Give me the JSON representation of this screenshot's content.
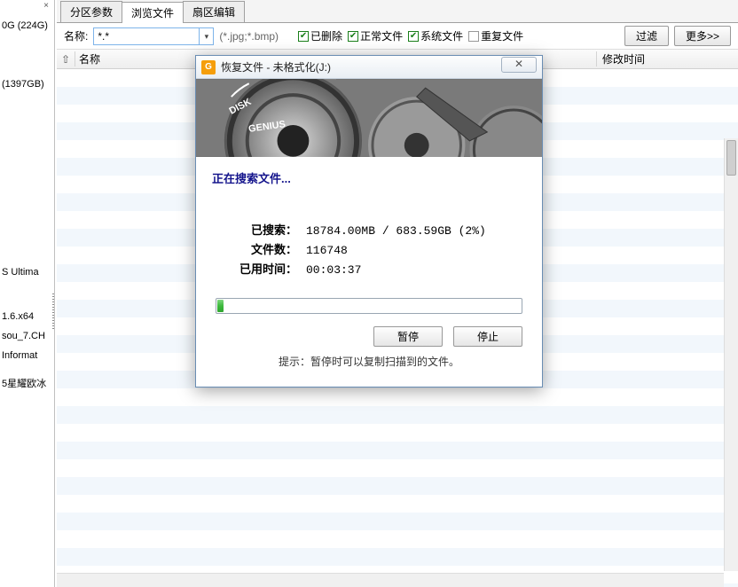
{
  "left": {
    "close": "×",
    "drive1": "0G (224G)",
    "drive2": "(1397GB)",
    "os": "S Ultima",
    "l1": "1.6.x64",
    "l2": "sou_7.CH",
    "l3": "Informat",
    "l4": "5星耀欧冰"
  },
  "tabs": {
    "t1": "分区参数",
    "t2": "浏览文件",
    "t3": "扇区编辑"
  },
  "filter": {
    "name_label": "名称:",
    "name_value": "*.*",
    "pattern_hint": "(*.jpg;*.bmp)",
    "chk_deleted": "已删除",
    "chk_normal": "正常文件",
    "chk_system": "系统文件",
    "chk_dup": "重复文件",
    "btn_filter": "过滤",
    "btn_more": "更多>>"
  },
  "listhead": {
    "up": "⇧",
    "name": "名称",
    "modtime": "修改时间"
  },
  "dialog": {
    "title": "恢复文件 - 未格式化(J:)",
    "close": "✕",
    "status": "正在搜索文件...",
    "searched_label": "已搜索：",
    "searched_value": "18784.00MB / 683.59GB (2%)",
    "files_label": "文件数：",
    "files_value": "116748",
    "elapsed_label": "已用时间：",
    "elapsed_value": "00:03:37",
    "progress_pct": 2,
    "btn_pause": "暂停",
    "btn_stop": "停止",
    "tip": "提示：暂停时可以复制扫描到的文件。"
  }
}
